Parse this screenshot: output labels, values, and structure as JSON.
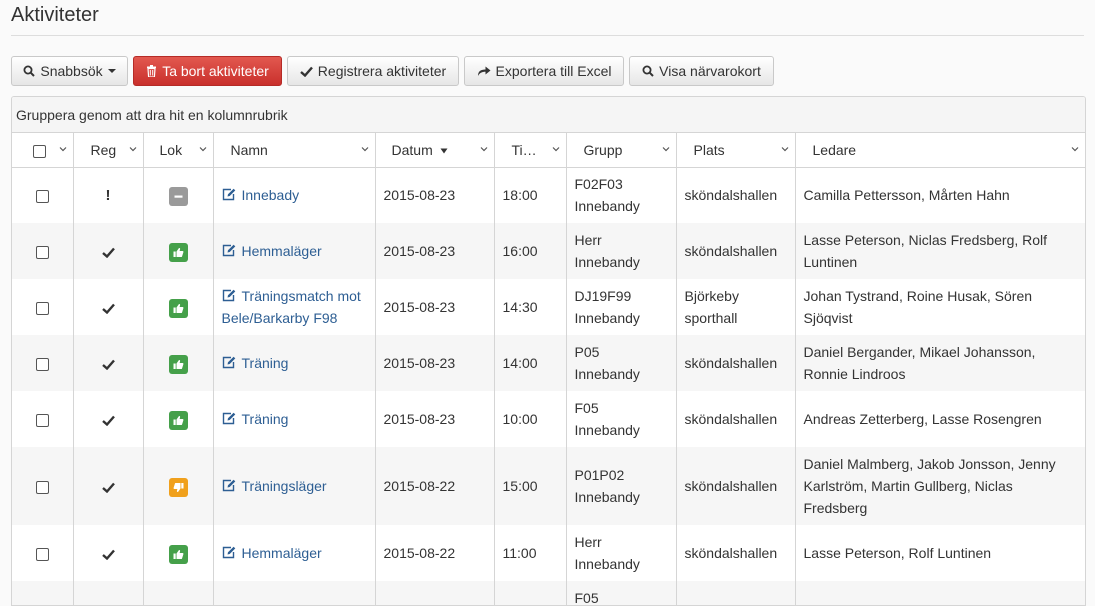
{
  "page": {
    "title": "Aktiviteter"
  },
  "toolbar": {
    "quicksearch_label": "Snabbsök",
    "delete_label": "Ta bort aktiviteter",
    "register_label": "Registrera aktiviteter",
    "export_label": "Exportera till Excel",
    "attendance_label": "Visa närvarokort"
  },
  "grid": {
    "group_hint": "Gruppera genom att dra hit en kolumnrubrik",
    "columns": {
      "reg": "Reg",
      "lok": "Lok",
      "namn": "Namn",
      "datum": "Datum",
      "tid": "Ti…",
      "grupp": "Grupp",
      "plats": "Plats",
      "ledare": "Ledare"
    },
    "rows": [
      {
        "reg": "!",
        "lok": "none",
        "namn": "Innebady",
        "datum": "2015-08-23",
        "tid": "18:00",
        "grupp": "F02F03 Innebandy",
        "plats": "sköndalshallen",
        "ledare": "Camilla Pettersson, Mårten Hahn"
      },
      {
        "reg": "check",
        "lok": "ok",
        "namn": "Hemmaläger",
        "datum": "2015-08-23",
        "tid": "16:00",
        "grupp": "Herr Innebandy",
        "plats": "sköndalshallen",
        "ledare": "Lasse Peterson, Niclas Fredsberg, Rolf Luntinen"
      },
      {
        "reg": "check",
        "lok": "ok",
        "namn": "Träningsmatch mot Bele/Barkarby F98",
        "datum": "2015-08-23",
        "tid": "14:30",
        "grupp": "DJ19F99 Innebandy",
        "plats": "Björkeby sporthall",
        "ledare": "Johan Tystrand, Roine Husak, Sören Sjöqvist"
      },
      {
        "reg": "check",
        "lok": "ok",
        "namn": "Träning",
        "datum": "2015-08-23",
        "tid": "14:00",
        "grupp": "P05 Innebandy",
        "plats": "sköndalshallen",
        "ledare": "Daniel Bergander, Mikael Johansson, Ronnie Lindroos"
      },
      {
        "reg": "check",
        "lok": "ok",
        "namn": "Träning",
        "datum": "2015-08-23",
        "tid": "10:00",
        "grupp": "F05 Innebandy",
        "plats": "sköndalshallen",
        "ledare": "Andreas Zetterberg, Lasse Rosengren"
      },
      {
        "reg": "check",
        "lok": "warn",
        "namn": "Träningsläger",
        "datum": "2015-08-22",
        "tid": "15:00",
        "grupp": "P01P02 Innebandy",
        "plats": "sköndalshallen",
        "ledare": "Daniel Malmberg, Jakob Jonsson, Jenny Karlström, Martin Gullberg, Niclas Fredsberg"
      },
      {
        "reg": "check",
        "lok": "ok",
        "namn": "Hemmaläger",
        "datum": "2015-08-22",
        "tid": "11:00",
        "grupp": "Herr Innebandy",
        "plats": "sköndalshallen",
        "ledare": "Lasse Peterson, Rolf Luntinen"
      },
      {
        "reg": "",
        "lok": "",
        "namn": "",
        "datum": "",
        "tid": "",
        "grupp": "F05",
        "plats": "",
        "ledare": ""
      }
    ]
  }
}
